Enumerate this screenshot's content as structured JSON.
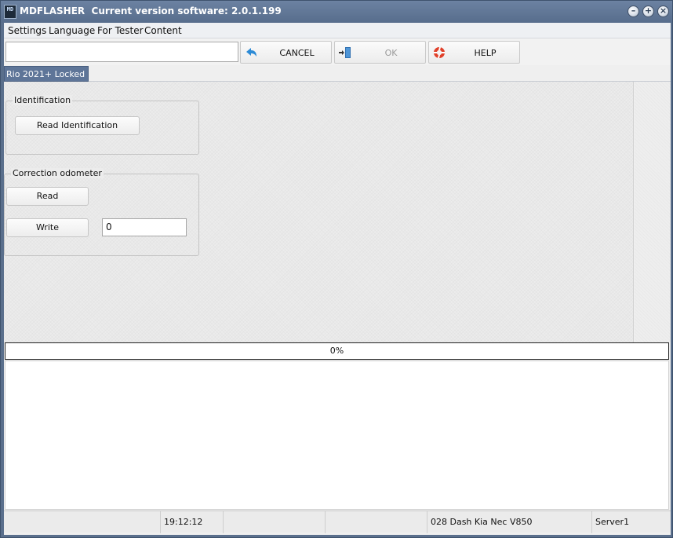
{
  "window": {
    "app_name": "MDFLASHER",
    "version_text": "Current version software: 2.0.1.199",
    "icon_text": "MD",
    "controls": [
      "minimize-icon",
      "maximize-icon",
      "close-icon"
    ]
  },
  "menu": {
    "items": [
      "Settings",
      "Language",
      "For Tester",
      "Content"
    ]
  },
  "toolbar": {
    "input_value": "",
    "cancel_label": "CANCEL",
    "ok_label": "OK",
    "help_label": "HELP",
    "cancel_icon": "undo-arrow-icon",
    "ok_icon": "exit-door-icon",
    "help_icon": "lifebuoy-icon"
  },
  "tab": {
    "label": "Rio 2021+ Locked"
  },
  "identification": {
    "group_title": "Identification",
    "read_button": "Read Identification"
  },
  "odometer": {
    "group_title": "Correction odometer",
    "read_button": "Read",
    "write_button": "Write",
    "value": "0"
  },
  "progress": {
    "label": "0%",
    "fraction": 0
  },
  "status": {
    "time": "19:12:12",
    "empty1": "",
    "empty2": "",
    "device": "028 Dash Kia Nec V850",
    "server": "Server1"
  },
  "colors": {
    "title_bar": "#5a6f8c",
    "tab_active": "#5e7598",
    "cancel_icon": "#2d8bd6",
    "help_icon": "#e0402a"
  }
}
